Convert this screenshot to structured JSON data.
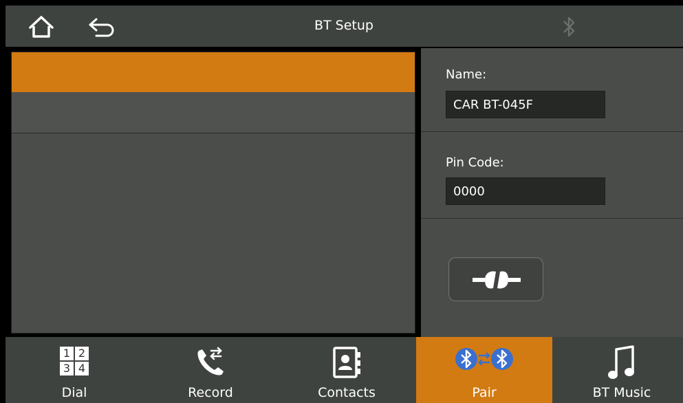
{
  "header": {
    "title": "BT Setup",
    "icons": [
      "home-icon",
      "back-arrow-icon",
      "bluetooth-icon"
    ]
  },
  "device_list": {
    "rows": [
      "",
      ""
    ]
  },
  "settings": {
    "name_label": "Name:",
    "name_value": "CAR BT-045F",
    "pin_label": "Pin Code:",
    "pin_value": "0000",
    "disconnect_icon": "disconnect-icon"
  },
  "nav": {
    "tabs": [
      {
        "label": "Dial",
        "icon": "dialpad-icon",
        "active": false,
        "keys": [
          "1",
          "2",
          "3",
          "4"
        ]
      },
      {
        "label": "Record",
        "icon": "call-record-icon",
        "active": false
      },
      {
        "label": "Contacts",
        "icon": "contacts-icon",
        "active": false
      },
      {
        "label": "Pair",
        "icon": "bluetooth-pair-icon",
        "active": true
      },
      {
        "label": "BT Music",
        "icon": "music-note-icon",
        "active": false
      }
    ]
  },
  "colors": {
    "accent": "#d27b12",
    "bar": "#3f4340",
    "panel": "#4a4c4a",
    "field": "#262826"
  }
}
